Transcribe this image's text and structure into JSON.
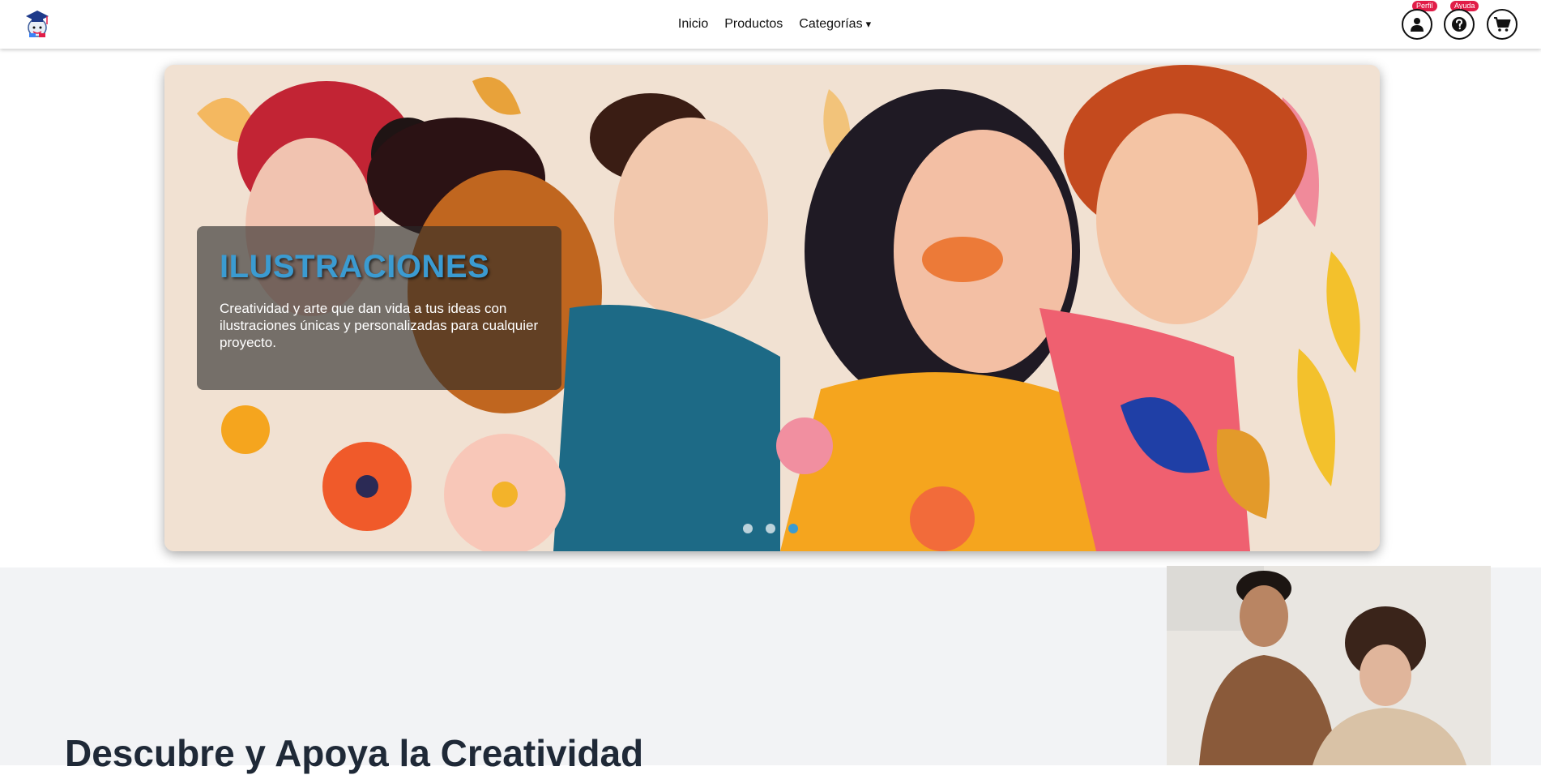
{
  "header": {
    "nav": [
      {
        "label": "Inicio"
      },
      {
        "label": "Productos"
      },
      {
        "label": "Categorías",
        "caret": "▾"
      }
    ],
    "profile_badge": "Perfil",
    "help_badge": "Ayuda",
    "icons": [
      "logo-graduation-icon",
      "user-icon",
      "help-icon",
      "cart-icon"
    ]
  },
  "hero": {
    "title": "ILUSTRACIONES",
    "description": "Creatividad y arte que dan vida a tus ideas con ilustraciones únicas y personalizadas para cualquier proyecto.",
    "slides": 3,
    "active_slide": 3
  },
  "section": {
    "heading": "Descubre y Apoya la Creatividad"
  },
  "colors": {
    "accent": "#3b9bd1",
    "badge": "#e11d48",
    "section_bg": "#f2f3f5",
    "heading": "#1f2937"
  }
}
